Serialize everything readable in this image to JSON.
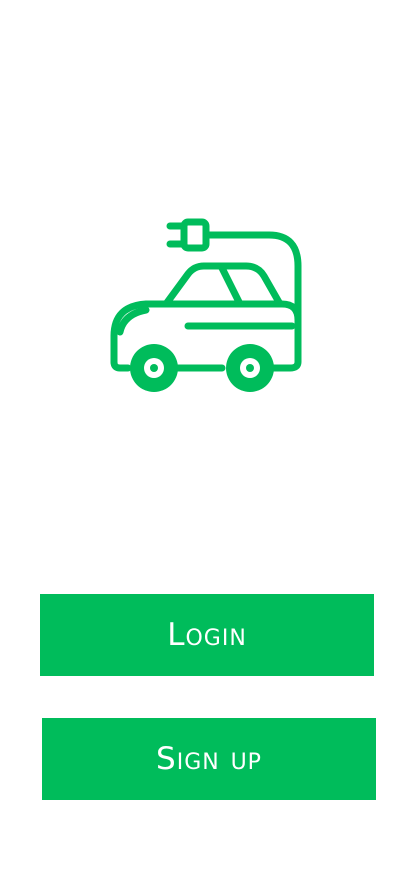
{
  "theme": {
    "accent": "#00BC5B",
    "background": "#FFFFFF"
  },
  "logo": {
    "icon": "electric-car-icon"
  },
  "buttons": {
    "login_label": "Login",
    "signup_label": "Sign up"
  }
}
